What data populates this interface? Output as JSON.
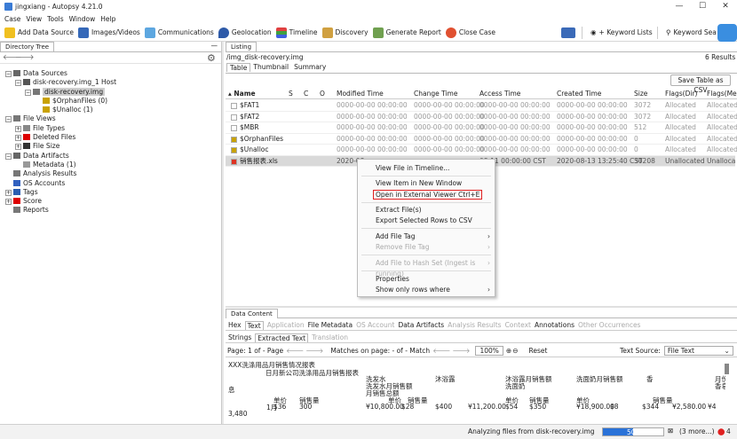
{
  "window": {
    "title": "jingxiang - Autopsy 4.21.0",
    "minimize": "—",
    "maximize": "☐",
    "close": "✕"
  },
  "menu": [
    "Case",
    "View",
    "Tools",
    "Window",
    "Help"
  ],
  "toolbar": {
    "add_data_source": "Add Data Source",
    "images_videos": "Images/Videos",
    "communications": "Communications",
    "geolocation": "Geolocation",
    "timeline": "Timeline",
    "discovery": "Discovery",
    "generate_report": "Generate Report",
    "close_case": "Close Case",
    "keyword_lists": "+ Keyword Lists",
    "keyword_search": "Keyword Sea"
  },
  "left": {
    "tab": "Directory Tree",
    "minimize": "—",
    "tree": [
      {
        "label": "Data Sources",
        "level": 0,
        "toggle": "−",
        "icon": "folder"
      },
      {
        "label": "disk-recovery.img_1 Host",
        "level": 1,
        "toggle": "−",
        "icon": "host"
      },
      {
        "label": "disk-recovery.img",
        "level": 2,
        "toggle": "−",
        "icon": "disk",
        "selected": true
      },
      {
        "label": "$OrphanFiles (0)",
        "level": 3,
        "toggle": "",
        "icon": "vfolder"
      },
      {
        "label": "$Unalloc (1)",
        "level": 3,
        "toggle": "",
        "icon": "vfolder"
      },
      {
        "label": "File Views",
        "level": 0,
        "toggle": "−",
        "icon": "views"
      },
      {
        "label": "File Types",
        "level": 1,
        "toggle": "+",
        "icon": "doc"
      },
      {
        "label": "Deleted Files",
        "level": 1,
        "toggle": "+",
        "icon": "deleted"
      },
      {
        "label": "File Size",
        "level": 1,
        "toggle": "+",
        "icon": "mb"
      },
      {
        "label": "Data Artifacts",
        "level": 0,
        "toggle": "−",
        "icon": "artifacts"
      },
      {
        "label": "Metadata (1)",
        "level": 1,
        "toggle": "",
        "icon": "meta"
      },
      {
        "label": "Analysis Results",
        "level": 0,
        "toggle": "",
        "icon": "analysis"
      },
      {
        "label": "OS Accounts",
        "level": 0,
        "toggle": "",
        "icon": "accounts"
      },
      {
        "label": "Tags",
        "level": 0,
        "toggle": "+",
        "icon": "tags"
      },
      {
        "label": "Score",
        "level": 0,
        "toggle": "+",
        "icon": "score"
      },
      {
        "label": "Reports",
        "level": 0,
        "toggle": "",
        "icon": "reports"
      }
    ]
  },
  "listing": {
    "tab": "Listing",
    "path": "/img_disk-recovery.img",
    "results": "6  Results",
    "subtabs": [
      "Table",
      "Thumbnail",
      "Summary"
    ],
    "save_btn": "Save Table as CSV",
    "columns": [
      "Name",
      "S",
      "C",
      "O",
      "Modified Time",
      "Change Time",
      "Access Time",
      "Created Time",
      "Size",
      "Flags(Dir)",
      "Flags(Me"
    ],
    "rows": [
      {
        "name": "$FAT1",
        "mod": "0000-00-00 00:00:00",
        "chg": "0000-00-00 00:00:00",
        "acc": "0000-00-00 00:00:00",
        "cre": "0000-00-00 00:00:00",
        "size": "3072",
        "fd": "Allocated",
        "fm": "Allocated"
      },
      {
        "name": "$FAT2",
        "mod": "0000-00-00 00:00:00",
        "chg": "0000-00-00 00:00:00",
        "acc": "0000-00-00 00:00:00",
        "cre": "0000-00-00 00:00:00",
        "size": "3072",
        "fd": "Allocated",
        "fm": "Allocated"
      },
      {
        "name": "$MBR",
        "mod": "0000-00-00 00:00:00",
        "chg": "0000-00-00 00:00:00",
        "acc": "0000-00-00 00:00:00",
        "cre": "0000-00-00 00:00:00",
        "size": "512",
        "fd": "Allocated",
        "fm": "Allocated"
      },
      {
        "name": "$OrphanFiles",
        "mod": "0000-00-00 00:00:00",
        "chg": "0000-00-00 00:00:00",
        "acc": "0000-00-00 00:00:00",
        "cre": "0000-00-00 00:00:00",
        "size": "0",
        "fd": "Allocated",
        "fm": "Allocated"
      },
      {
        "name": "$Unalloc",
        "mod": "0000-00-00 00:00:00",
        "chg": "0000-00-00 00:00:00",
        "acc": "0000-00-00 00:00:00",
        "cre": "0000-00-00 00:00:00",
        "size": "0",
        "fd": "Allocated",
        "fm": "Allocated"
      },
      {
        "name": "销售报表.xls",
        "mod": "2020-08",
        "chg": "",
        "acc": "08-11 00:00:00 CST",
        "cre": "2020-08-13 13:25:40 CST",
        "size": "30208",
        "fd": "Unallocated",
        "fm": "Unalloca"
      }
    ]
  },
  "context_menu": {
    "items": [
      "View File in Timeline...",
      "View Item in New Window",
      "Open in External Viewer  Ctrl+E",
      "Extract File(s)",
      "Export Selected Rows to CSV",
      "Add File Tag",
      "Remove File Tag",
      "Add File to Hash Set (Ingest is running)",
      "Properties",
      "Show only rows where"
    ],
    "highlight_color": "#e02020"
  },
  "content": {
    "tab": "Data Content",
    "tabs1": [
      "Hex",
      "Text",
      "Application",
      "File Metadata",
      "OS Account",
      "Data Artifacts",
      "Analysis Results",
      "Context",
      "Annotations",
      "Other Occurrences"
    ],
    "tabs2": [
      "Strings",
      "Extracted Text",
      "Translation"
    ],
    "page_label": "Page: 1 of - Page",
    "matches_label": "Matches on page:  - of  -  Match",
    "zoom": "100%",
    "reset": "Reset",
    "text_source_label": "Text Source:",
    "text_source_value": "File Text",
    "lines": [
      "XXX洗涤用品月销售情况报表",
      "日月新公司洗涤用品月销售报表",
      "洗发水",
      "洗发水月销售额",
      "沐浴露",
      "沐浴露月销售额",
      "洗面奶",
      "洗面奶月销售额",
      "香",
      "月份",
      "香皂月销售额",
      "月销售总额",
      "息",
      "单价",
      "销售量",
      "单价",
      "销售量",
      "单价",
      "销售量",
      "单价",
      "销售量",
      "1月",
      "$36",
      "300",
      "¥10,800.00",
      "$28",
      "$400",
      "¥11,200.00",
      "$54",
      "$350",
      "¥18,900.00",
      "$8",
      "$344",
      "¥2,580.00",
      "¥4",
      "3,480"
    ]
  },
  "status": {
    "text": "Analyzing files from disk-recovery.img",
    "progress": 0.5,
    "progress_label": "50%",
    "more": "(3 more...)",
    "alerts": "4"
  }
}
